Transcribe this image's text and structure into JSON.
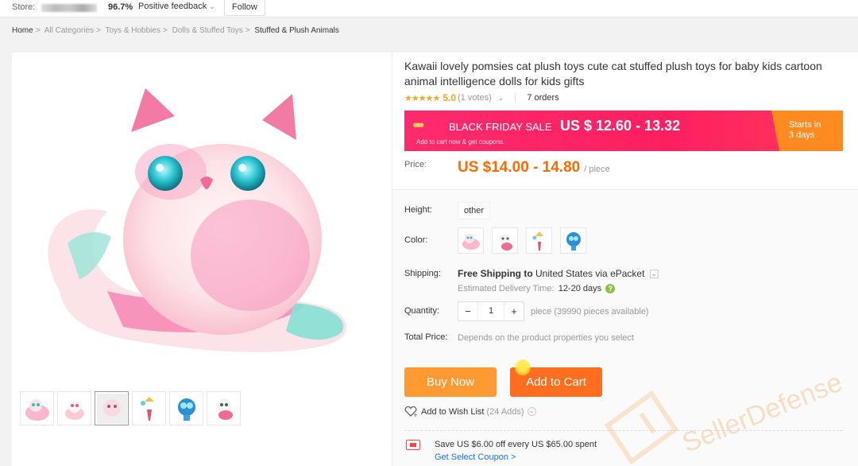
{
  "store_bar": {
    "store_label": "Store:",
    "feedback_pct": "96.7%",
    "feedback_label": "Positive feedback",
    "feedback_chevron": "⌄",
    "follow_label": "Follow"
  },
  "breadcrumb": [
    "Home",
    "All Categories",
    "Toys & Hobbies",
    "Dolls & Stuffed Toys",
    "Stuffed & Plush Animals"
  ],
  "breadcrumb_sep": ">",
  "product": {
    "title": "Kawaii lovely pomsies cat plush toys cute cat stuffed plush toys for baby kids cartoon animal intelligence dolls for kids gifts",
    "stars": "★★★★★",
    "rating": "5.0",
    "votes": "(1 votes)",
    "votes_chevron": "⌄",
    "orders": "7 orders"
  },
  "sale_banner": {
    "label": "BLACK FRIDAY SALE",
    "price": "US $ 12.60 - 13.32",
    "sub": "Add to cart now & get coupons.",
    "starts_line1": "Starts in",
    "starts_line2": "3 days",
    "colors": {
      "banner": "#ff2a6d",
      "starts": "#ff8a1f"
    }
  },
  "price": {
    "label": "Price:",
    "value": "US $14.00 - 14.80",
    "unit": "/ piece"
  },
  "attributes": {
    "height_label": "Height:",
    "height_option": "other",
    "color_label": "Color:",
    "color_options": [
      "pink-white-cat",
      "white-cat",
      "rainbow-unicorn",
      "blue-owl"
    ],
    "shipping_label": "Shipping:",
    "shipping_free": "Free Shipping to",
    "shipping_dest": "United States via ePacket",
    "shipping_chevron": "⌄",
    "est_label": "Estimated Delivery Time:",
    "est_days": "12-20 days",
    "est_help": "?",
    "quantity_label": "Quantity:",
    "qty_minus": "−",
    "qty_value": "1",
    "qty_plus": "+",
    "qty_avail": "piece (39990 pieces available)",
    "total_label": "Total Price:",
    "total_value": "Depends on the product properties you select"
  },
  "actions": {
    "buy_now": "Buy Now",
    "add_to_cart": "Add to Cart",
    "wish_label": "Add to Wish List",
    "wish_adds": "(24 Adds)",
    "wish_chevron": "⌄"
  },
  "coupon": {
    "line": "Save US $6.00 off every US $65.00 spent",
    "link": "Get Select Coupon >"
  },
  "watermark": "SellerDefense",
  "colors": {
    "accent": "#ff6a00",
    "buy_now": "#ff9a33",
    "add_to_cart": "#ff6d1f",
    "star": "#f5a623",
    "link": "#1a73e8"
  }
}
